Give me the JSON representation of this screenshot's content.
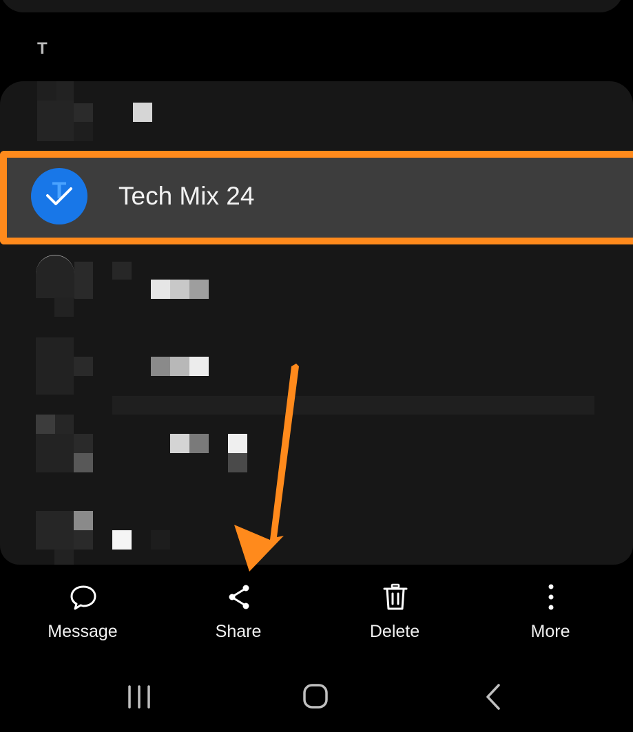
{
  "section": {
    "letter": "T"
  },
  "selected_contact": {
    "name": "Tech Mix 24",
    "initial": "T"
  },
  "actions": [
    {
      "label": "Message",
      "icon": "message-icon"
    },
    {
      "label": "Share",
      "icon": "share-icon"
    },
    {
      "label": "Delete",
      "icon": "delete-icon"
    },
    {
      "label": "More",
      "icon": "more-vertical-icon"
    }
  ],
  "navigation": {
    "recents": "recent-apps-icon",
    "home": "home-icon",
    "back": "back-icon"
  },
  "colors": {
    "highlight": "#ff8a1c",
    "avatar": "#1877e8",
    "card": "#171717",
    "selected_row": "#3d3d3d"
  }
}
